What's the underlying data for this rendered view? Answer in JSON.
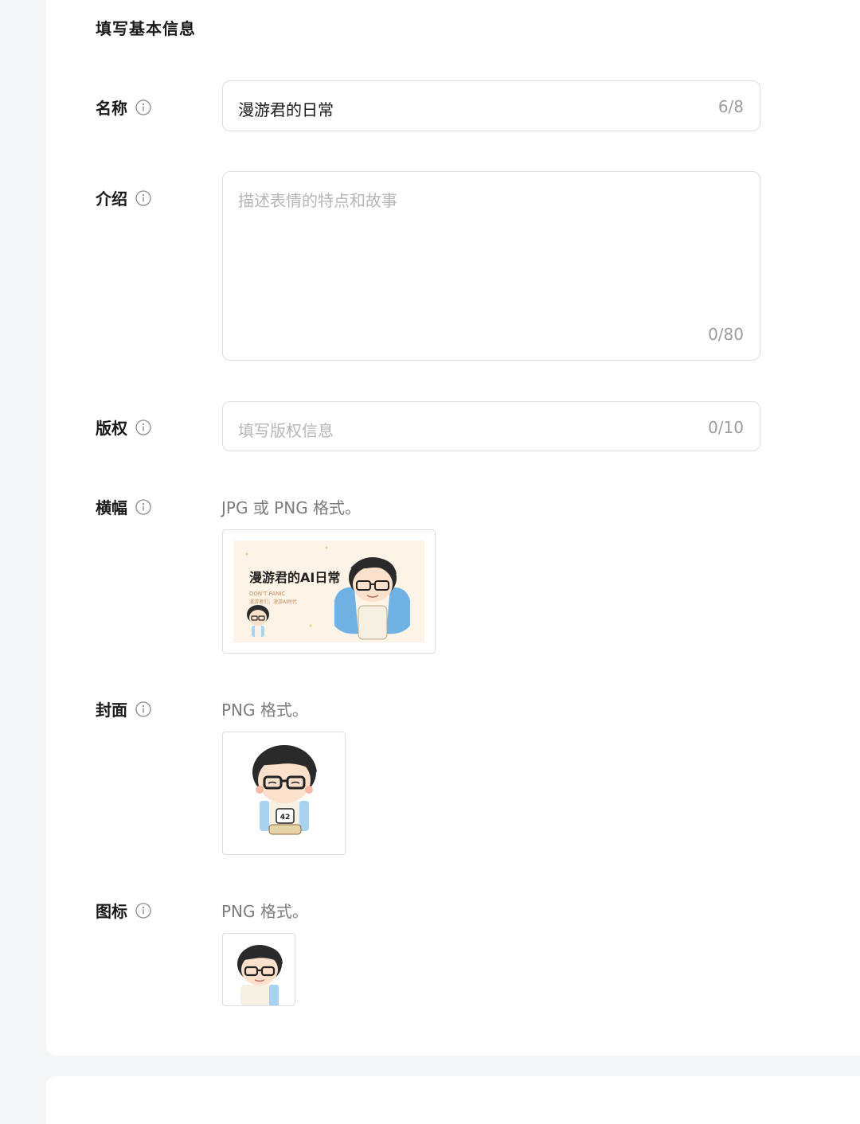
{
  "section": {
    "title": "填写基本信息"
  },
  "name": {
    "label": "名称",
    "value": "漫游君的日常",
    "counter": "6/8"
  },
  "intro": {
    "label": "介绍",
    "placeholder": "描述表情的特点和故事",
    "counter": "0/80"
  },
  "copyright": {
    "label": "版权",
    "placeholder": "填写版权信息",
    "counter": "0/10"
  },
  "banner": {
    "label": "横幅",
    "hint": "JPG 或 PNG 格式。",
    "image_text": "漫游君的AI日常",
    "image_subtext": "DON'T PANIC",
    "image_subtext2": "漫游者们，漫游AI时代"
  },
  "cover": {
    "label": "封面",
    "hint": "PNG 格式。",
    "mug_text": "42"
  },
  "icon": {
    "label": "图标",
    "hint": "PNG 格式。"
  },
  "colors": {
    "border": "#dcdde0",
    "page_bg": "#f4f5f7",
    "banner_bg": "#fdf4e7",
    "shirt_blue": "#a9d2f0"
  }
}
